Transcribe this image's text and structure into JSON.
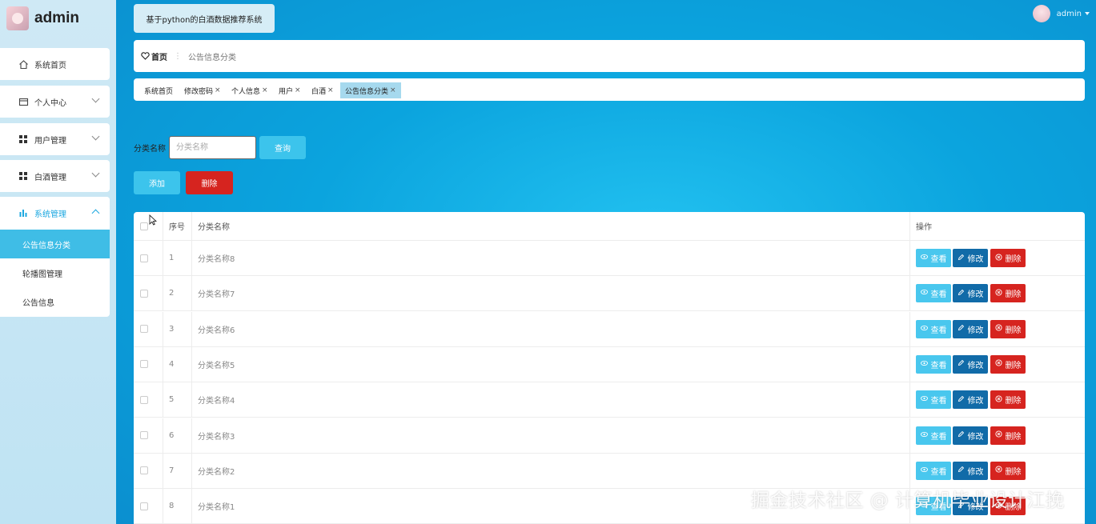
{
  "app": {
    "name": "admin",
    "system_title": "基于python的白酒数据推荐系统"
  },
  "user": {
    "name": "admin"
  },
  "sidebar": {
    "items": [
      {
        "label": "系统首页",
        "icon": "home-icon"
      },
      {
        "label": "个人中心",
        "icon": "profile-card-icon"
      },
      {
        "label": "用户管理",
        "icon": "grid-icon"
      },
      {
        "label": "白酒管理",
        "icon": "grid-icon"
      },
      {
        "label": "系统管理",
        "icon": "bar-chart-icon"
      }
    ],
    "sub_items": [
      {
        "label": "公告信息分类",
        "active": true
      },
      {
        "label": "轮播图管理",
        "active": false
      },
      {
        "label": "公告信息",
        "active": false
      }
    ]
  },
  "breadcrumb": {
    "home": "首页",
    "separator": "⋮",
    "current": "公告信息分类"
  },
  "tabs": [
    {
      "label": "系统首页",
      "closable": false,
      "active": false
    },
    {
      "label": "修改密码",
      "closable": true,
      "active": false
    },
    {
      "label": "个人信息",
      "closable": true,
      "active": false
    },
    {
      "label": "用户",
      "closable": true,
      "active": false
    },
    {
      "label": "白酒",
      "closable": true,
      "active": false
    },
    {
      "label": "公告信息分类",
      "closable": true,
      "active": true
    }
  ],
  "tab_close_glyph": "×",
  "filter": {
    "label": "分类名称",
    "placeholder": "分类名称",
    "value": "",
    "query_button": "查询"
  },
  "actions": {
    "add": "添加",
    "delete": "删除"
  },
  "table": {
    "columns": [
      "序号",
      "分类名称",
      "操作"
    ],
    "row_actions": {
      "view": "查看",
      "edit": "修改",
      "delete": "删除"
    },
    "rows": [
      {
        "index": "1",
        "name": "分类名称8"
      },
      {
        "index": "2",
        "name": "分类名称7"
      },
      {
        "index": "3",
        "name": "分类名称6"
      },
      {
        "index": "4",
        "name": "分类名称5"
      },
      {
        "index": "5",
        "name": "分类名称4"
      },
      {
        "index": "6",
        "name": "分类名称3"
      },
      {
        "index": "7",
        "name": "分类名称2"
      },
      {
        "index": "8",
        "name": "分类名称1"
      }
    ]
  },
  "watermark": "掘金技术社区 @ 计算机毕业设计江挽",
  "colors": {
    "accent": "#3cc4ec",
    "danger": "#d6241f",
    "edit": "#116ba8",
    "header_bg": "#0ba4de"
  }
}
